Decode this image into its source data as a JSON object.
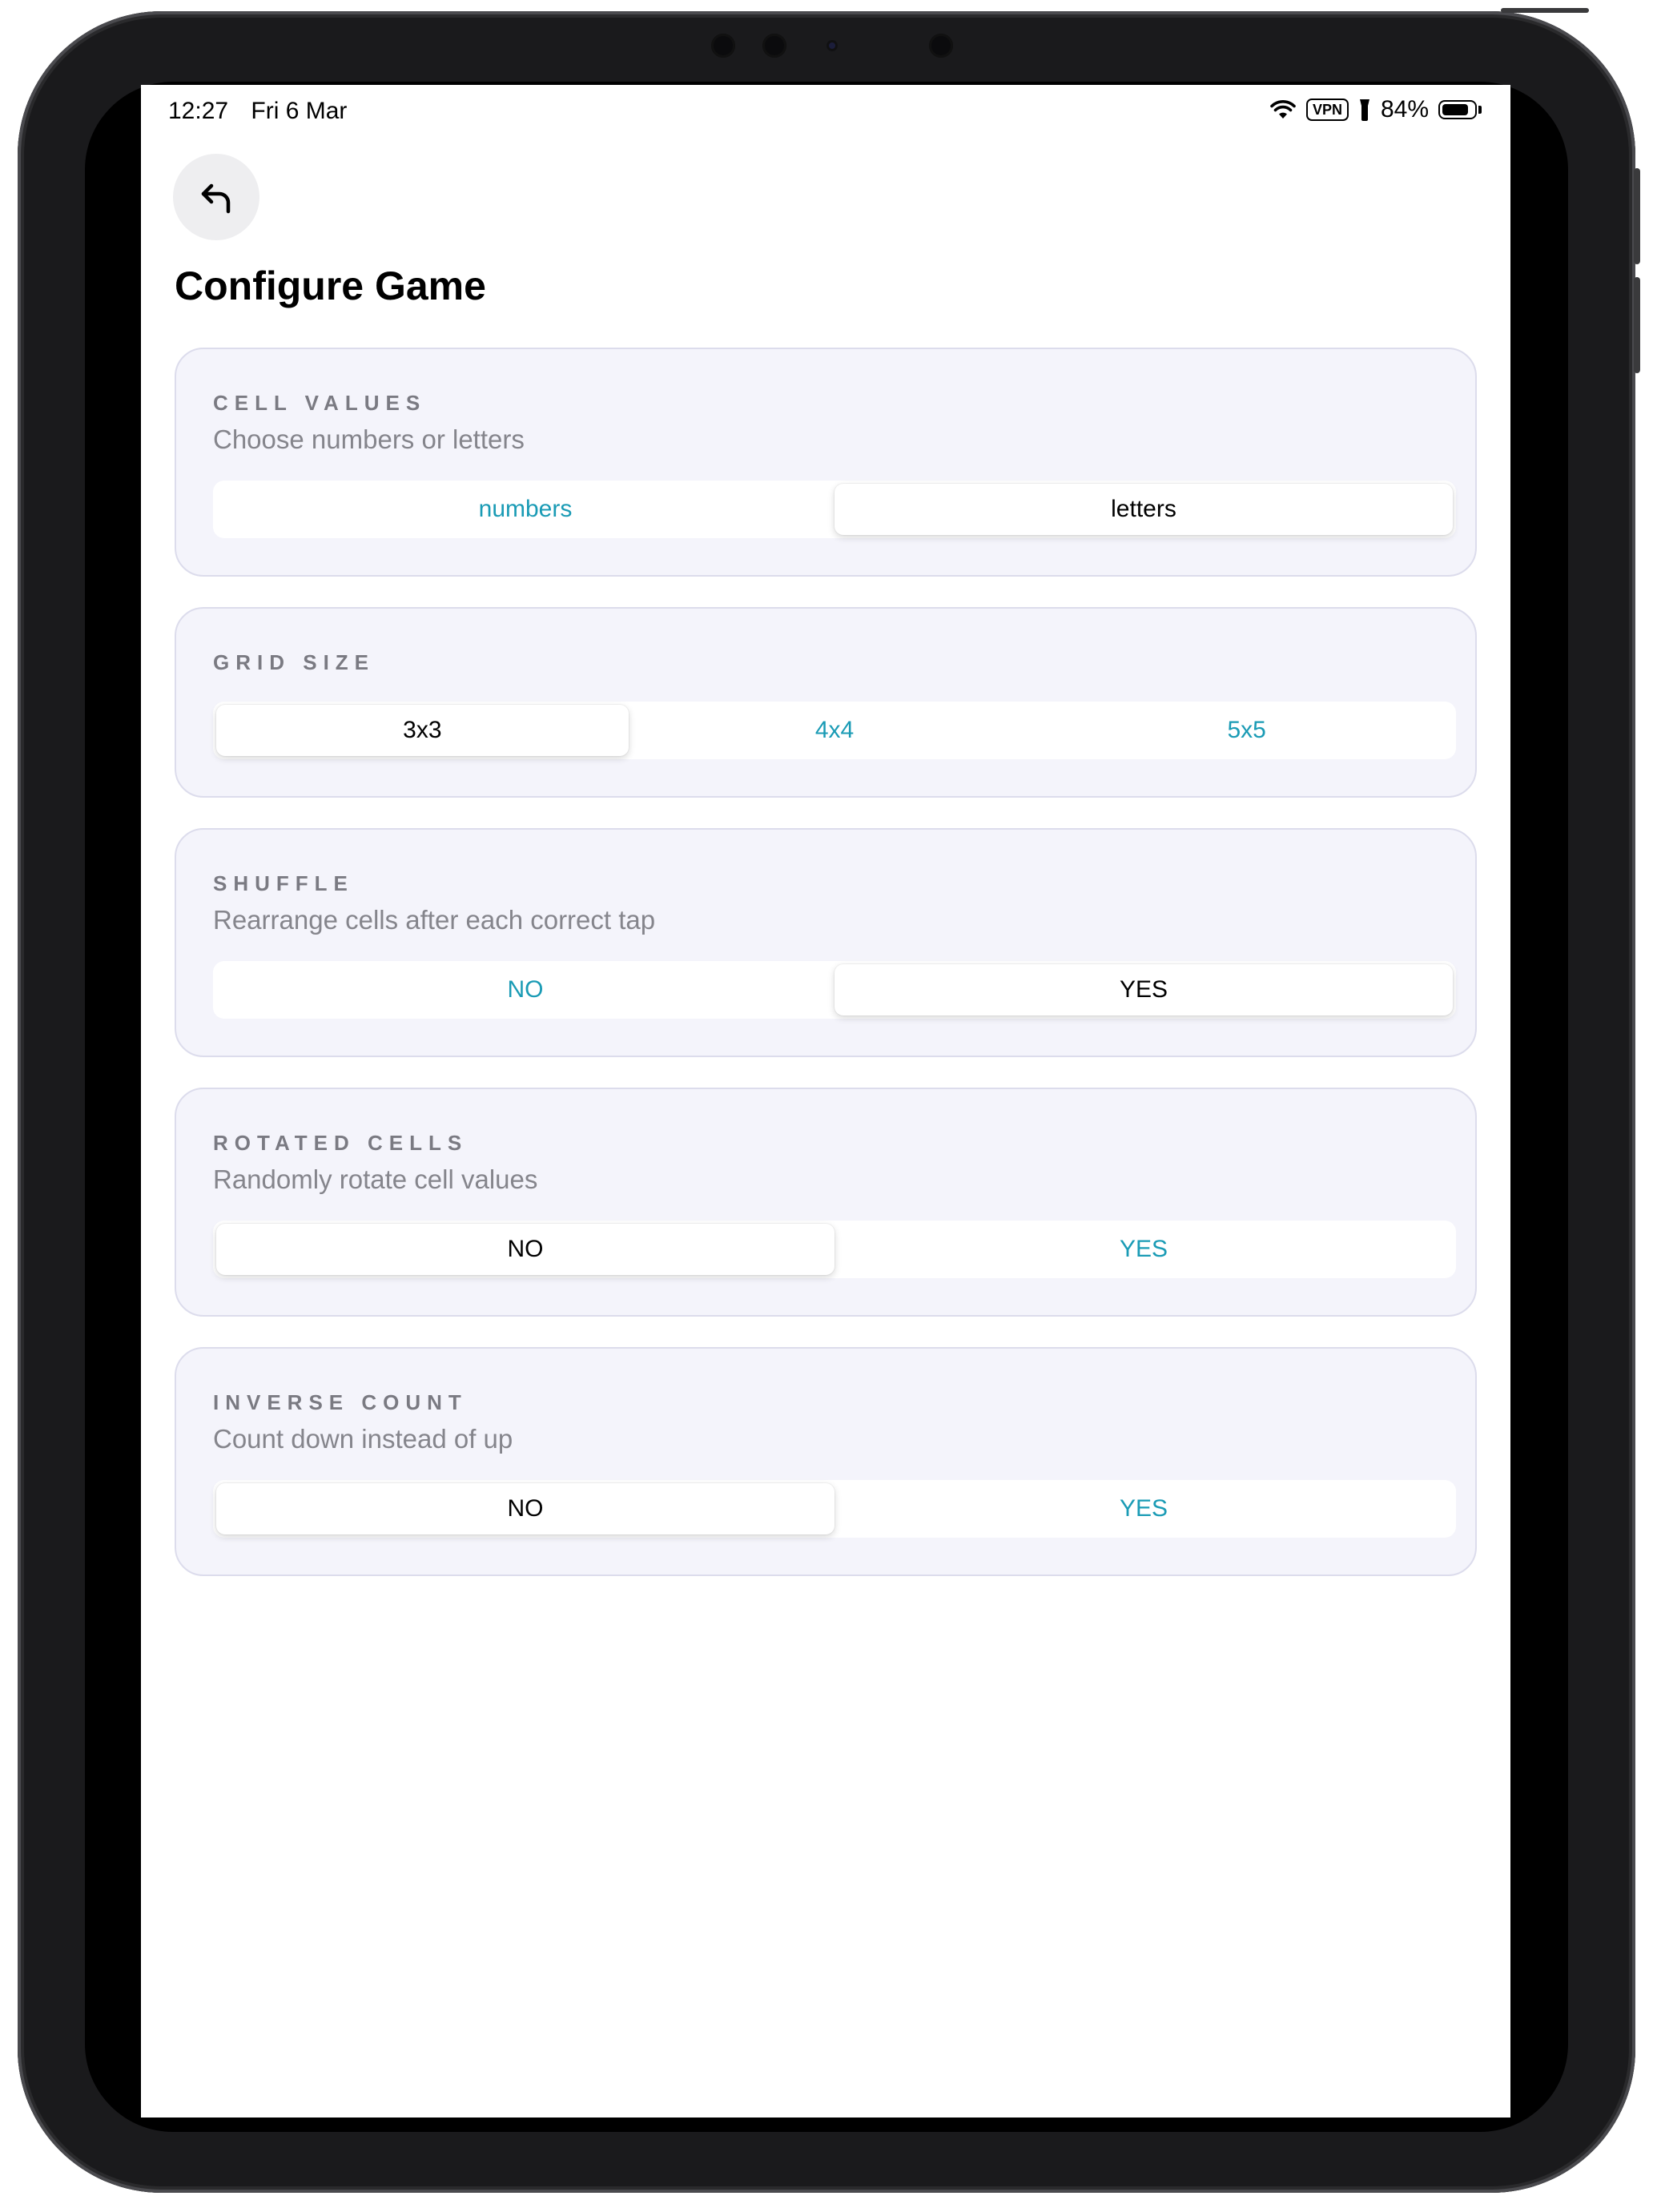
{
  "status_bar": {
    "time": "12:27",
    "date": "Fri 6 Mar",
    "vpn": "VPN",
    "battery": "84%",
    "battery_level": 0.84
  },
  "header": {
    "back_icon": "back-arrow-icon",
    "title": "Configure Game"
  },
  "colors": {
    "accent": "#1a9bb5",
    "card_bg": "#f4f4fb",
    "label": "#7a7a82"
  },
  "settings": [
    {
      "title": "CELL VALUES",
      "subtitle": "Choose numbers or letters",
      "options": [
        "numbers",
        "letters"
      ],
      "selected": "letters"
    },
    {
      "title": "GRID SIZE",
      "subtitle": "",
      "options": [
        "3x3",
        "4x4",
        "5x5"
      ],
      "selected": "3x3"
    },
    {
      "title": "SHUFFLE",
      "subtitle": "Rearrange cells after each correct tap",
      "options": [
        "NO",
        "YES"
      ],
      "selected": "YES"
    },
    {
      "title": "ROTATED CELLS",
      "subtitle": "Randomly rotate cell values",
      "options": [
        "NO",
        "YES"
      ],
      "selected": "NO"
    },
    {
      "title": "INVERSE COUNT",
      "subtitle": "Count down instead of up",
      "options": [
        "NO",
        "YES"
      ],
      "selected": "NO"
    }
  ]
}
